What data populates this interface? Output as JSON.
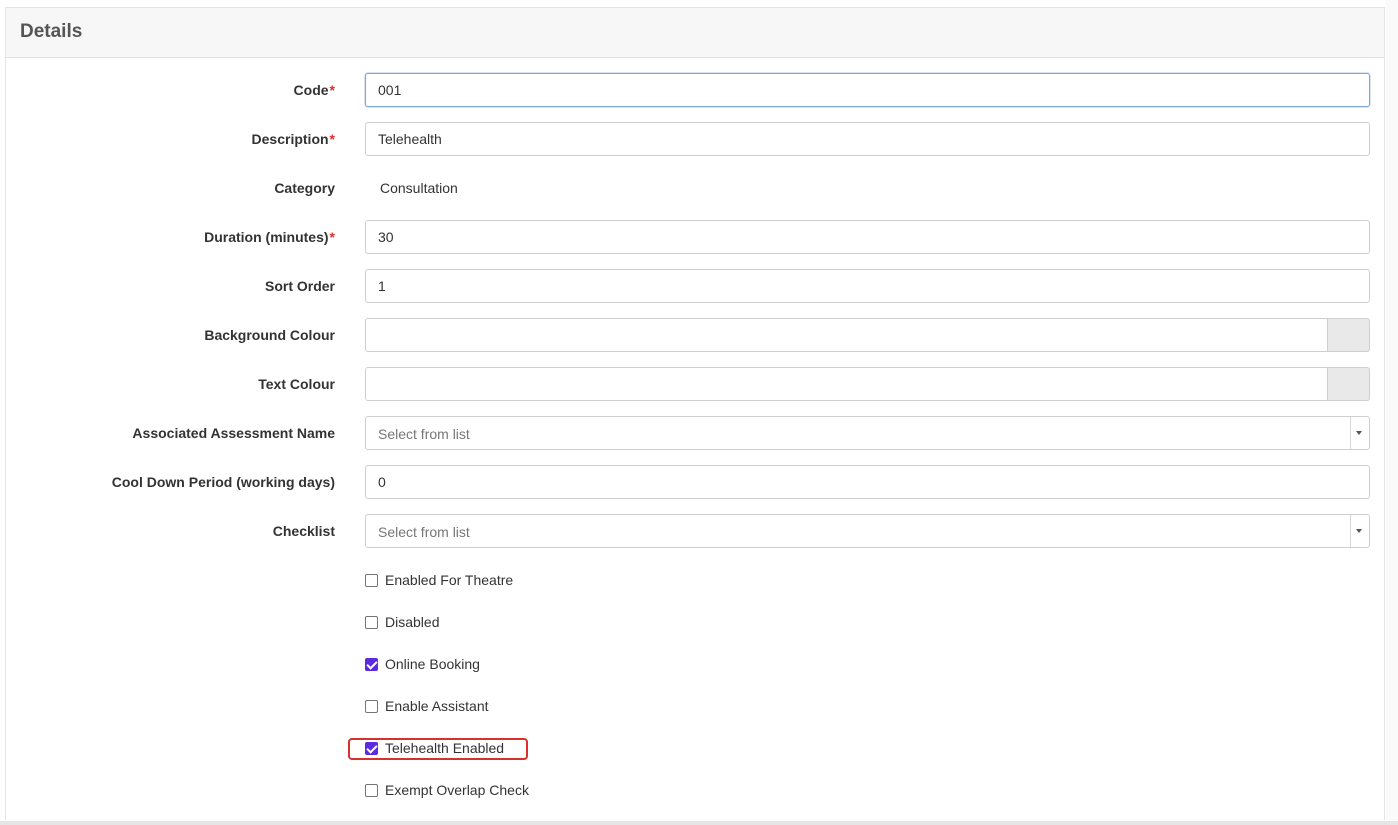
{
  "panel": {
    "title": "Details"
  },
  "fields": {
    "code": {
      "label": "Code",
      "required": "*",
      "value": "001"
    },
    "description": {
      "label": "Description",
      "required": "*",
      "value": "Telehealth"
    },
    "category": {
      "label": "Category",
      "value": "Consultation"
    },
    "duration": {
      "label": "Duration (minutes)",
      "required": "*",
      "value": "30"
    },
    "sort_order": {
      "label": "Sort Order",
      "value": "1"
    },
    "background_colour": {
      "label": "Background Colour",
      "value": ""
    },
    "text_colour": {
      "label": "Text Colour",
      "value": ""
    },
    "assessment": {
      "label": "Associated Assessment Name",
      "placeholder": "Select from list"
    },
    "cool_down": {
      "label": "Cool Down Period (working days)",
      "value": "0"
    },
    "checklist": {
      "label": "Checklist",
      "placeholder": "Select from list"
    }
  },
  "checkboxes": [
    {
      "label": "Enabled For Theatre",
      "checked": false
    },
    {
      "label": "Disabled",
      "checked": false
    },
    {
      "label": "Online Booking",
      "checked": true
    },
    {
      "label": "Enable Assistant",
      "checked": false
    },
    {
      "label": "Telehealth Enabled",
      "checked": true,
      "highlighted": true
    },
    {
      "label": "Exempt Overlap Check",
      "checked": false
    }
  ],
  "colors": {
    "accent": "#5b2be0",
    "required": "#d9302c",
    "highlight": "#d9302c"
  }
}
